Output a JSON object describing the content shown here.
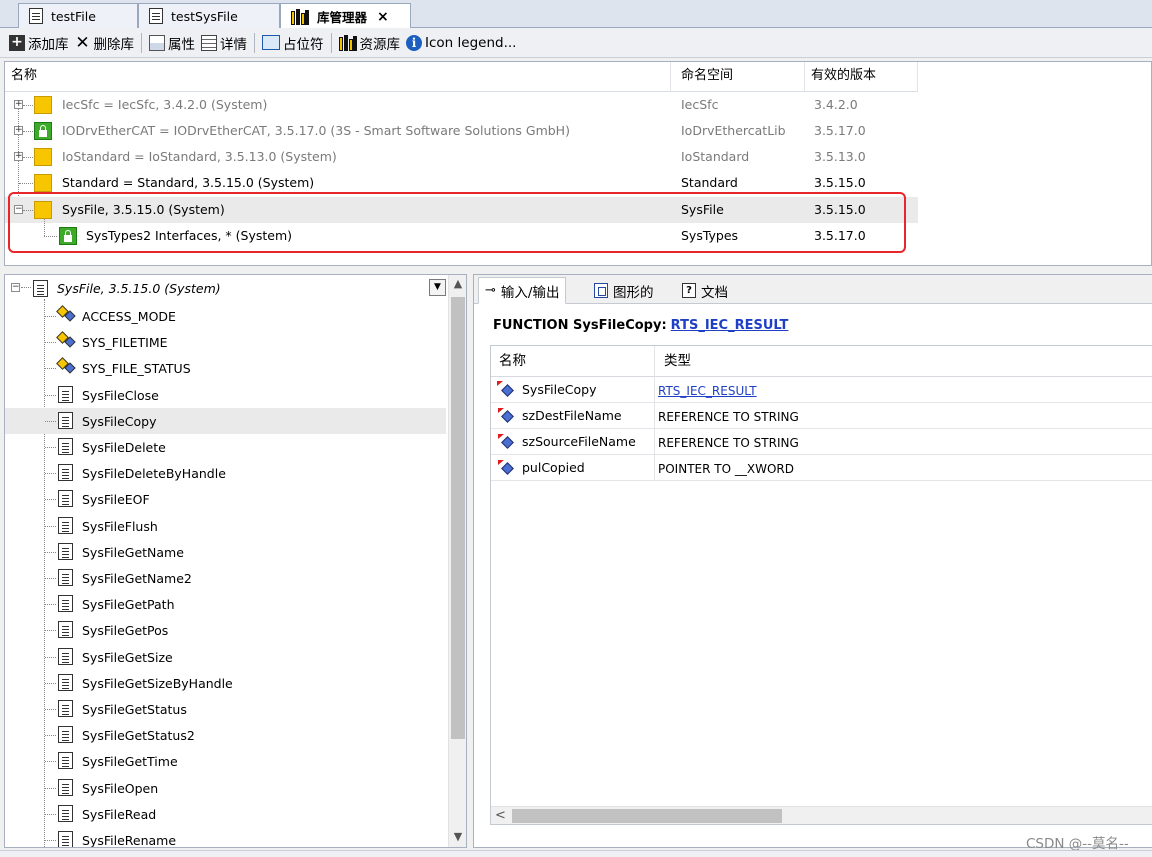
{
  "tabs": [
    {
      "label": "testFile",
      "icon": "document-icon",
      "active": false
    },
    {
      "label": "testSysFile",
      "icon": "document-icon",
      "active": false
    },
    {
      "label": "库管理器",
      "icon": "library-icon",
      "active": true,
      "close": "×"
    }
  ],
  "toolbar": {
    "add_icon": "+",
    "add_label": "添加库",
    "delete_icon": "✕",
    "delete_label": "删除库",
    "properties_label": "属性",
    "details_label": "详情",
    "placeholder_label": "占位符",
    "repository_label": "资源库",
    "info_icon": "i",
    "legend_label": "Icon legend..."
  },
  "libraries": {
    "headers": [
      "名称",
      "命名空间",
      "有效的版本"
    ],
    "rows": [
      {
        "name": "IecSfc = IecSfc, 3.4.2.0 (System)",
        "namespace": "IecSfc",
        "version": "3.4.2.0",
        "icon": "library-icon",
        "dim": true
      },
      {
        "name": "IODrvEtherCAT = IODrvEtherCAT, 3.5.17.0 (3S - Smart Software Solutions GmbH)",
        "namespace": "IoDrvEthercatLib",
        "version": "3.5.17.0",
        "icon": "shield-library-icon",
        "dim": true
      },
      {
        "name": "IoStandard = IoStandard, 3.5.13.0 (System)",
        "namespace": "IoStandard",
        "version": "3.5.13.0",
        "icon": "library-icon",
        "dim": true
      },
      {
        "name": "Standard = Standard, 3.5.15.0 (System)",
        "namespace": "Standard",
        "version": "3.5.15.0",
        "icon": "library-icon",
        "dim": false
      },
      {
        "name": "SysFile, 3.5.15.0 (System)",
        "namespace": "SysFile",
        "version": "3.5.15.0",
        "icon": "library-icon",
        "dim": false
      },
      {
        "name": "SysTypes2 Interfaces, * (System)",
        "namespace": "SysTypes",
        "version": "3.5.17.0",
        "icon": "locked-library-icon",
        "dim": false
      }
    ],
    "expander": "+",
    "collapse": "−"
  },
  "tree": {
    "root_label": "SysFile, 3.5.15.0 (System)",
    "combo_arrow": "▼",
    "scroll_up": "▲",
    "scroll_down": "▼",
    "items": [
      {
        "label": "ACCESS_MODE",
        "kind": "type"
      },
      {
        "label": "SYS_FILETIME",
        "kind": "type"
      },
      {
        "label": "SYS_FILE_STATUS",
        "kind": "type"
      },
      {
        "label": "SysFileClose",
        "kind": "function"
      },
      {
        "label": "SysFileCopy",
        "kind": "function",
        "selected": true
      },
      {
        "label": "SysFileDelete",
        "kind": "function"
      },
      {
        "label": "SysFileDeleteByHandle",
        "kind": "function"
      },
      {
        "label": "SysFileEOF",
        "kind": "function"
      },
      {
        "label": "SysFileFlush",
        "kind": "function"
      },
      {
        "label": "SysFileGetName",
        "kind": "function"
      },
      {
        "label": "SysFileGetName2",
        "kind": "function"
      },
      {
        "label": "SysFileGetPath",
        "kind": "function"
      },
      {
        "label": "SysFileGetPos",
        "kind": "function"
      },
      {
        "label": "SysFileGetSize",
        "kind": "function"
      },
      {
        "label": "SysFileGetSizeByHandle",
        "kind": "function"
      },
      {
        "label": "SysFileGetStatus",
        "kind": "function"
      },
      {
        "label": "SysFileGetStatus2",
        "kind": "function"
      },
      {
        "label": "SysFileGetTime",
        "kind": "function"
      },
      {
        "label": "SysFileOpen",
        "kind": "function"
      },
      {
        "label": "SysFileRead",
        "kind": "function"
      },
      {
        "label": "SysFileRename",
        "kind": "function"
      }
    ]
  },
  "detail": {
    "tabs": [
      {
        "label": "输入/输出",
        "icon": "io-icon",
        "glyph": "⊸"
      },
      {
        "label": "图形的",
        "icon": "graphic-icon"
      },
      {
        "label": "文档",
        "icon": "help-doc-icon",
        "glyph": "?"
      }
    ],
    "function_prefix": "FUNCTION SysFileCopy:",
    "function_return": "RTS_IEC_RESULT",
    "headers": [
      "名称",
      "类型"
    ],
    "rows": [
      {
        "name": "SysFileCopy",
        "type": "RTS_IEC_RESULT",
        "link": true,
        "kind": "return"
      },
      {
        "name": "szDestFileName",
        "type": "REFERENCE TO STRING",
        "link": false,
        "kind": "input"
      },
      {
        "name": "szSourceFileName",
        "type": "REFERENCE TO STRING",
        "link": false,
        "kind": "input"
      },
      {
        "name": "pulCopied",
        "type": "POINTER TO __XWORD",
        "link": false,
        "kind": "input"
      }
    ],
    "scroll_left": "<"
  },
  "watermark": "CSDN @--莫名--",
  "colors": {
    "highlight_border": "#e8262b",
    "link": "#1f3fc4",
    "library_yellow": "#f7c600",
    "lock_green": "#3daa2a"
  }
}
